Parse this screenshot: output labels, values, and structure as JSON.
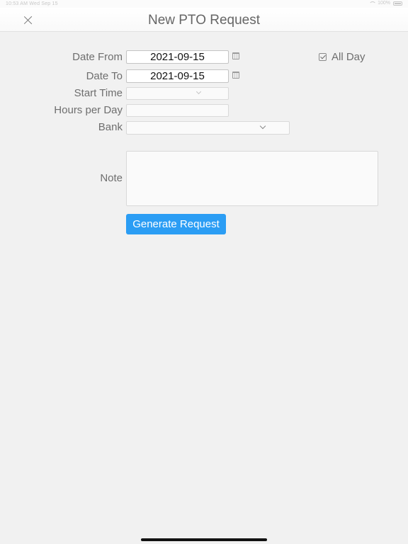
{
  "status_bar": {
    "left_text": "10:53 AM   Wed Sep 15",
    "right_text": "100%"
  },
  "nav": {
    "title": "New PTO Request",
    "close_icon": "close-icon"
  },
  "form": {
    "date_from": {
      "label": "Date From",
      "value": "2021-09-15",
      "icon": "calendar-icon"
    },
    "date_to": {
      "label": "Date To",
      "value": "2021-09-15",
      "icon": "calendar-icon"
    },
    "all_day": {
      "label": "All Day",
      "checked": true
    },
    "start_time": {
      "label": "Start Time",
      "value": ""
    },
    "hours_per_day": {
      "label": "Hours per Day",
      "value": ""
    },
    "bank": {
      "label": "Bank",
      "value": ""
    },
    "note": {
      "label": "Note",
      "value": ""
    },
    "submit_label": "Generate Request"
  },
  "colors": {
    "accent": "#2b9df4",
    "background": "#f1f1f1"
  }
}
